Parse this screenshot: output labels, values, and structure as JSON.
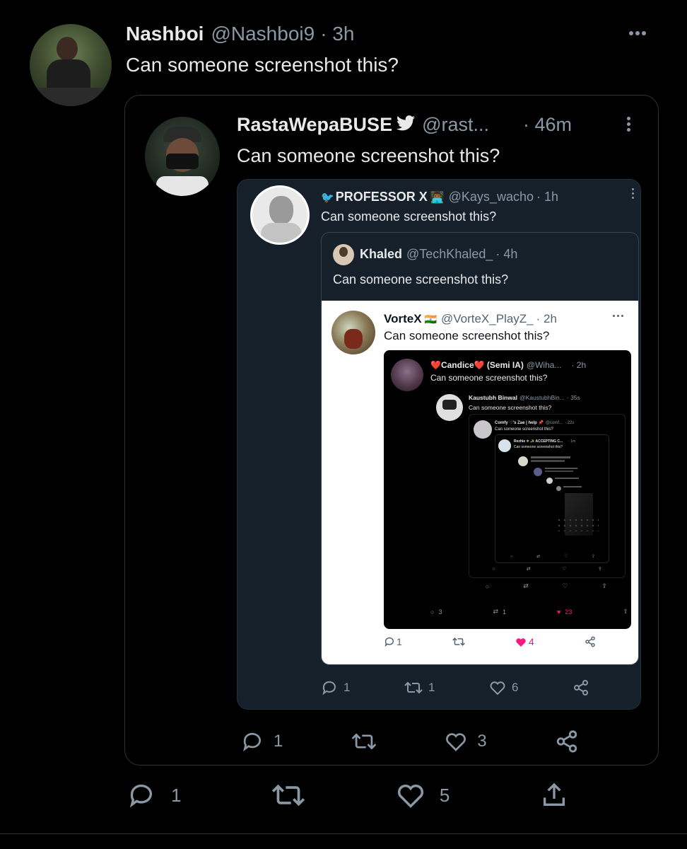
{
  "tweet": {
    "name": "Nashboi",
    "handle": "@Nashboi9",
    "time": "· 3h",
    "text": "Can someone screenshot this?",
    "replies": "1",
    "retweets": "",
    "likes": "5"
  },
  "quote1": {
    "name": "RastaWepaBUSE",
    "verified": "🐦",
    "handle": "@rast...",
    "time": "· 46m",
    "text": "Can someone screenshot this?",
    "replies": "1",
    "retweets": "",
    "likes": "3"
  },
  "quote2": {
    "prefix": "🐦",
    "name": "PROFESSOR X",
    "emoji": "👨🏾‍💻",
    "handle": "@Kays_wacho",
    "time": "· 1h",
    "text": "Can someone screenshot this?",
    "replies": "1",
    "retweets": "1",
    "likes": "6"
  },
  "quote3": {
    "name": "Khaled",
    "handle": "@TechKhaled_",
    "time": "· 4h",
    "text": "Can someone screenshot this?"
  },
  "quote4": {
    "name": "VorteX",
    "flag": "🇮🇳",
    "handle": "@VorteX_PlayZ_",
    "time": "· 2h",
    "text": "Can someone screenshot this?",
    "replies": "1",
    "retweets": "",
    "likes": "4"
  },
  "quote5": {
    "name": "❤️Candice❤️ (Semi IA)",
    "handle": "@Wiha...",
    "time": "· 2h",
    "text": "Can someone screenshot this?",
    "replies": "3",
    "retweets": "1",
    "likes": "23"
  },
  "quote6": {
    "name": "Kaustubh Binwal",
    "handle": "@KaustubhBin...",
    "time": "· 35s",
    "text": "Can someone screenshot this?"
  },
  "quote7": {
    "name": "Comfy ♡'s Zae | help 📌",
    "handle": "@comf...",
    "time": "· 22s",
    "text": "Can someone screenshot this?"
  },
  "quote8": {
    "name": "Rezhie ❄ ✨ ACCEPTING C...",
    "handle": "",
    "time": "· 1m",
    "text": "Can someone screenshot this?"
  },
  "colors": {
    "background": "#000000",
    "card_border": "#2f3336",
    "dim_bg": "#15202b",
    "light_bg": "#ffffff",
    "like_pink": "#f91880",
    "muted": "#8b98a5"
  }
}
